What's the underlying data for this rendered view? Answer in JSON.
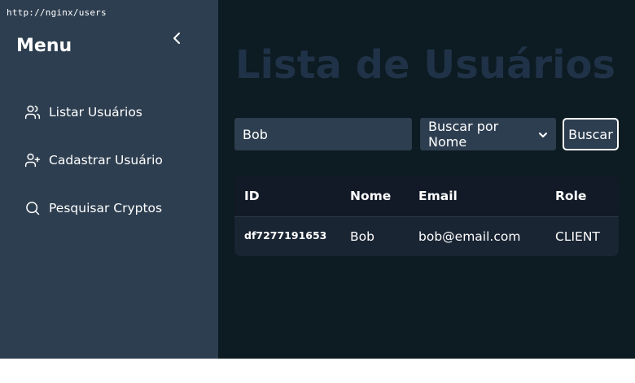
{
  "browser": {
    "url": "http://nginx/users"
  },
  "sidebar": {
    "title": "Menu",
    "collapse_icon": "chevron-left-icon",
    "items": [
      {
        "label": "Listar Usuários",
        "icon": "users-icon"
      },
      {
        "label": "Cadastrar Usuário",
        "icon": "user-plus-icon"
      },
      {
        "label": "Pesquisar Cryptos",
        "icon": "search-icon"
      }
    ]
  },
  "main": {
    "title": "Lista de Usuários",
    "search": {
      "value": "Bob",
      "selected_option": "Buscar por Nome",
      "button_label": "Buscar"
    },
    "table": {
      "headers": [
        "ID",
        "Nome",
        "Email",
        "Role"
      ],
      "rows": [
        [
          "df7277191653",
          "Bob",
          "bob@email.com",
          "CLIENT"
        ]
      ]
    }
  },
  "colors": {
    "sidebar_bg": "#2d3e50",
    "main_bg": "#0d1b22",
    "title_color": "#1f3247",
    "text": "#ffffff"
  }
}
